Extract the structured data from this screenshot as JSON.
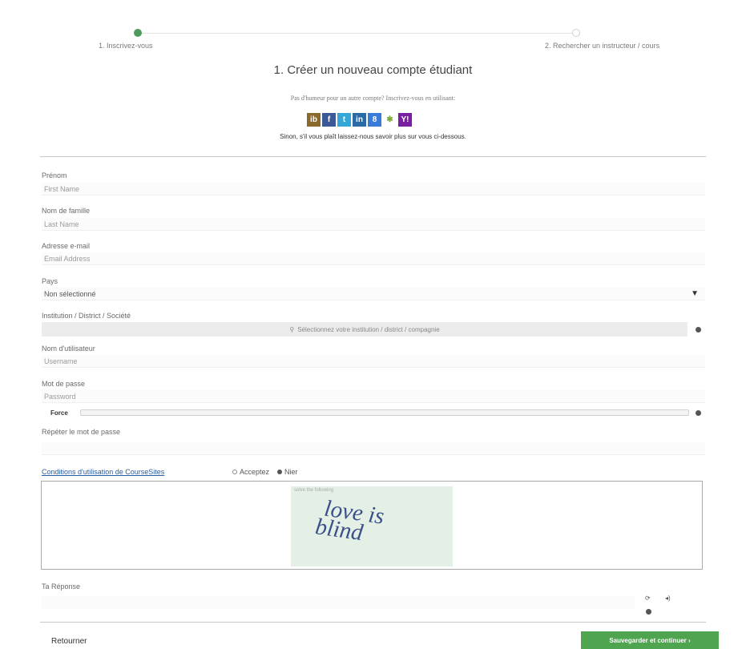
{
  "stepper": {
    "step1": "1. Inscrivez-vous",
    "step2": "2. Rechercher un instructeur / cours"
  },
  "header": {
    "title": "1. Créer un nouveau compte étudiant",
    "subtitle": "Pas d'humeur pour un autre compte? Inscrivez-vous en utilisant:",
    "tagline": "Sinon, s'il vous plaît laissez-nous savoir plus sur vous ci-dessous."
  },
  "social_buttons": [
    {
      "glyph": "ib",
      "icon": "ib-icon",
      "color": "#8a6a2a"
    },
    {
      "glyph": "f",
      "icon": "facebook-icon",
      "color": "#3b5998"
    },
    {
      "glyph": "t",
      "icon": "twitter-icon",
      "color": "#33a8d8"
    },
    {
      "glyph": "in",
      "icon": "linkedin-icon",
      "color": "#2a6aa5"
    },
    {
      "glyph": "8",
      "icon": "google-icon",
      "color": "#3a7ad8"
    },
    {
      "glyph": "✱",
      "icon": "windows-live-icon",
      "color": "#7aaa3a"
    },
    {
      "glyph": "Y!",
      "icon": "yahoo-icon",
      "color": "#7a1fa2"
    }
  ],
  "form": {
    "first_name": {
      "label": "Prénom",
      "placeholder": "First Name"
    },
    "last_name": {
      "label": "Nom de famille",
      "placeholder": "Last Name"
    },
    "email": {
      "label": "Adresse e-mail",
      "placeholder": "Email Address"
    },
    "country": {
      "label": "Pays",
      "value": "Non sélectionné"
    },
    "institution": {
      "label": "Institution / District / Société",
      "placeholder": "Sélectionnez votre institution / district / compagnie"
    },
    "username": {
      "label": "Nom d'utilisateur",
      "placeholder": "Username"
    },
    "password": {
      "label": "Mot de passe",
      "placeholder": "Password"
    },
    "strength_label": "Force",
    "repeat_password": {
      "label": "Répéter le mot de passe"
    }
  },
  "terms": {
    "link": "Conditions d'utilisation de CourseSites",
    "accept": "Acceptez",
    "deny": "Nier"
  },
  "captcha": {
    "header": "solve the following",
    "text_line1": "love is",
    "text_line2": "blind",
    "answer_label": "Ta Réponse"
  },
  "footer": {
    "back": "Retourner",
    "save": "Sauvegarder et continuer ›"
  }
}
